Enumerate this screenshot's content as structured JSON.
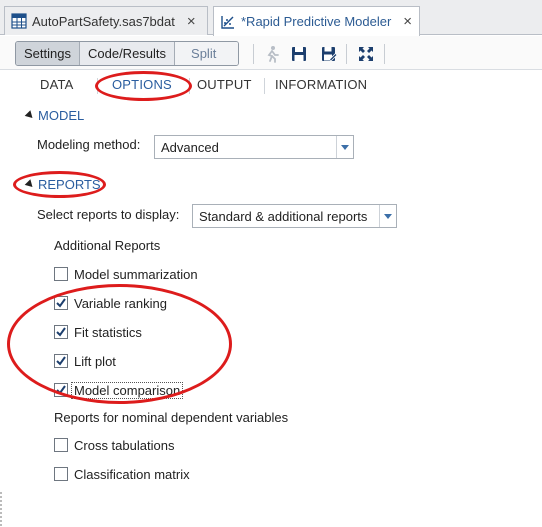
{
  "tabs": [
    {
      "label": "AutoPartSafety.sas7bdat",
      "icon": "table-icon",
      "close": "×",
      "active": false
    },
    {
      "label": "*Rapid Predictive Modeler",
      "icon": "task-icon",
      "close": "×",
      "active": true
    }
  ],
  "toolbar": {
    "segments": [
      "Settings",
      "Code/Results",
      "Split"
    ],
    "icons": [
      "run-icon",
      "save-icon",
      "save-as-icon",
      "maximize-icon"
    ]
  },
  "subtabs": [
    "DATA",
    "OPTIONS",
    "OUTPUT",
    "INFORMATION"
  ],
  "active_subtab": "OPTIONS",
  "model": {
    "heading": "MODEL",
    "method_label": "Modeling method:",
    "method_value": "Advanced"
  },
  "reports": {
    "heading": "REPORTS",
    "select_label": "Select reports to display:",
    "select_value": "Standard & additional reports",
    "additional_heading": "Additional Reports",
    "additional": [
      {
        "label": "Model summarization",
        "checked": false
      },
      {
        "label": "Variable ranking",
        "checked": true
      },
      {
        "label": "Fit statistics",
        "checked": true
      },
      {
        "label": "Lift plot",
        "checked": true
      },
      {
        "label": "Model comparison",
        "checked": true
      }
    ],
    "nominal_heading": "Reports for nominal dependent variables",
    "nominal": [
      {
        "label": "Cross tabulations",
        "checked": false
      },
      {
        "label": "Classification matrix",
        "checked": false
      }
    ]
  },
  "colors": {
    "accent": "#2a5d9f",
    "annotation": "#dd1c1c"
  }
}
